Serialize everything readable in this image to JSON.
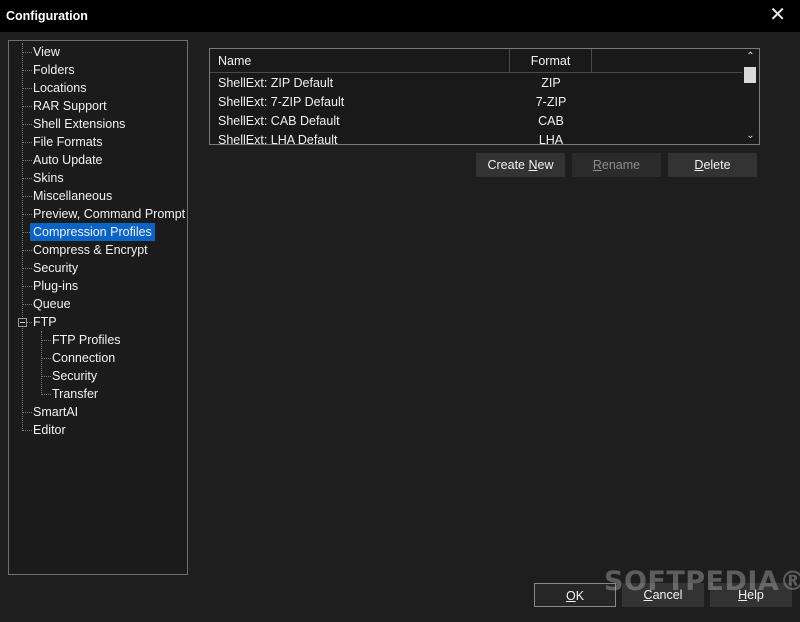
{
  "window": {
    "title": "Configuration",
    "close_symbol": "✕"
  },
  "tree": {
    "items": [
      {
        "label": "View"
      },
      {
        "label": "Folders"
      },
      {
        "label": "Locations"
      },
      {
        "label": "RAR Support"
      },
      {
        "label": "Shell Extensions"
      },
      {
        "label": "File Formats"
      },
      {
        "label": "Auto Update"
      },
      {
        "label": "Skins"
      },
      {
        "label": "Miscellaneous"
      },
      {
        "label": "Preview, Command Prompt"
      },
      {
        "label": "Compression Profiles",
        "selected": true
      },
      {
        "label": "Compress & Encrypt"
      },
      {
        "label": "Security"
      },
      {
        "label": "Plug-ins"
      },
      {
        "label": "Queue"
      },
      {
        "label": "FTP",
        "expanded": true
      },
      {
        "label": "FTP Profiles"
      },
      {
        "label": "Connection"
      },
      {
        "label": "Security"
      },
      {
        "label": "Transfer"
      },
      {
        "label": "SmartAI"
      },
      {
        "label": "Editor"
      }
    ]
  },
  "profiles_table": {
    "columns": [
      "Name",
      "Format"
    ],
    "rows": [
      {
        "name": "ShellExt: ZIP Default",
        "format": "ZIP"
      },
      {
        "name": "ShellExt: 7-ZIP Default",
        "format": "7-ZIP"
      },
      {
        "name": "ShellExt: CAB Default",
        "format": "CAB"
      },
      {
        "name": "ShellExt: LHA Default",
        "format": "LHA"
      }
    ]
  },
  "actions": {
    "create_new": {
      "before": "Create ",
      "mnemonic": "N",
      "after": "ew"
    },
    "rename": {
      "before": "",
      "mnemonic": "R",
      "after": "ename"
    },
    "delete": {
      "before": "",
      "mnemonic": "D",
      "after": "elete"
    }
  },
  "dialog_buttons": {
    "ok": {
      "before": "",
      "mnemonic": "O",
      "after": "K"
    },
    "cancel": {
      "before": "",
      "mnemonic": "C",
      "after": "ancel"
    },
    "help": {
      "before": "",
      "mnemonic": "H",
      "after": "elp"
    }
  },
  "watermark": "SOFTPEDIA®"
}
